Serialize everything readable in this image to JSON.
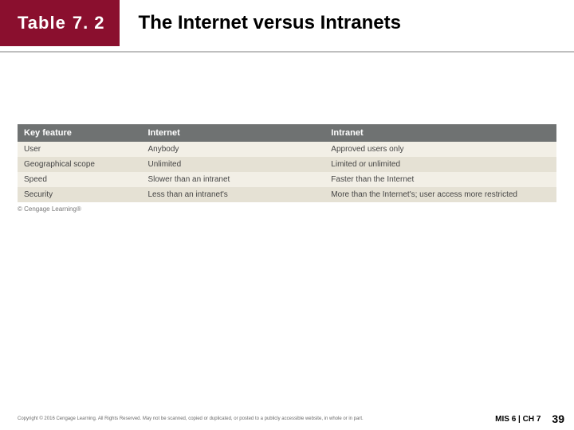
{
  "header": {
    "table_word": "Table",
    "table_number": "7. 2",
    "title": "The Internet versus Intranets"
  },
  "table": {
    "headers": [
      "Key feature",
      "Internet",
      "Intranet"
    ],
    "rows": [
      {
        "feature": "User",
        "internet": "Anybody",
        "intranet": "Approved users only"
      },
      {
        "feature": "Geographical scope",
        "internet": "Unlimited",
        "intranet": "Limited or unlimited"
      },
      {
        "feature": "Speed",
        "internet": "Slower than an intranet",
        "intranet": "Faster than the Internet"
      },
      {
        "feature": "Security",
        "internet": "Less than an intranet's",
        "intranet": "More than the Internet's; user access more restricted"
      }
    ]
  },
  "attribution": "© Cengage Learning®",
  "footer": {
    "copyright": "Copyright © 2016 Cengage Learning. All Rights Reserved. May not be scanned, copied or duplicated, or posted to a publicly accessible website, in whole or in part.",
    "chapter": "MIS 6 | CH 7",
    "page": "39"
  }
}
